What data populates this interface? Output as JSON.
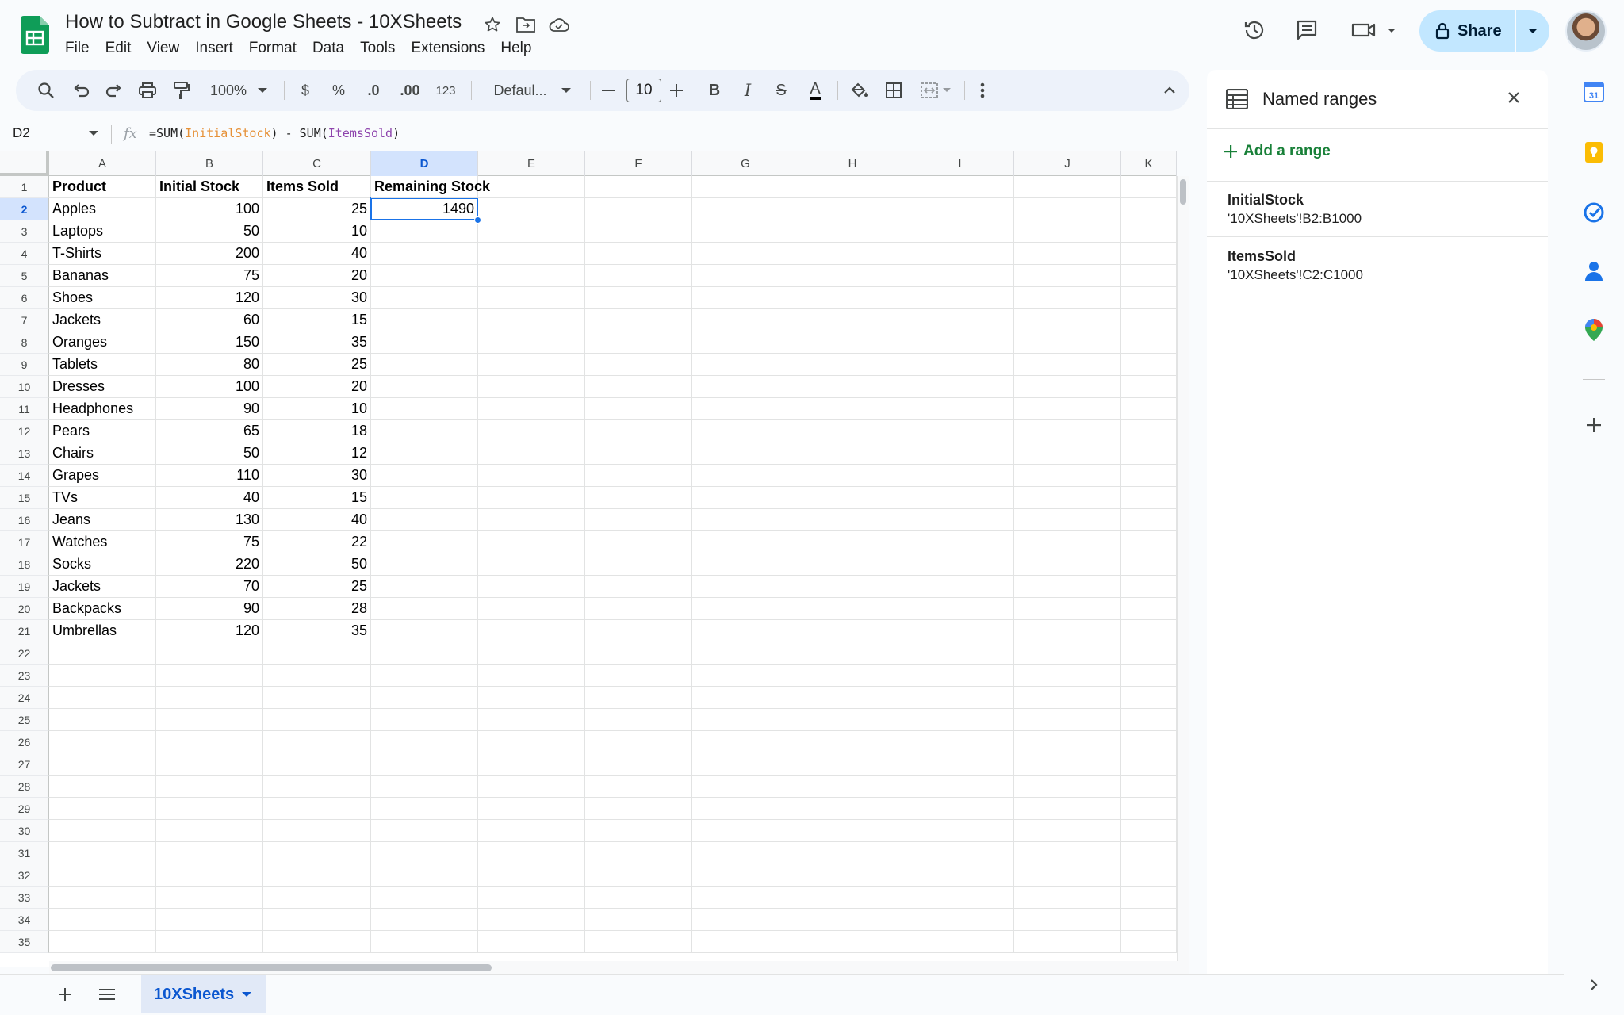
{
  "app": {
    "doc_title": "How to Subtract in Google Sheets - 10XSheets",
    "menu": [
      "File",
      "Edit",
      "View",
      "Insert",
      "Format",
      "Data",
      "Tools",
      "Extensions",
      "Help"
    ],
    "share_label": "Share"
  },
  "toolbar": {
    "zoom": "100%",
    "currency": "$",
    "percent": "%",
    "dec_decrease": ".0",
    "dec_increase": ".00",
    "number_format": "123",
    "font": "Defaul...",
    "font_size": "10",
    "bold": "B",
    "italic": "I",
    "strike": "S",
    "text_color": "A"
  },
  "formula_bar": {
    "cell_ref": "D2",
    "fx": "fx",
    "formula_prefix": "=SUM(",
    "formula_arg1": "InitialStock",
    "formula_mid": ") - SUM(",
    "formula_arg2": "ItemsSold",
    "formula_suffix": ")"
  },
  "grid": {
    "columns": [
      "A",
      "B",
      "C",
      "D",
      "E",
      "F",
      "G",
      "H",
      "I",
      "J",
      "K"
    ],
    "selected_column": "D",
    "row_numbers": [
      "1",
      "2",
      "3",
      "4",
      "5",
      "6",
      "7",
      "8",
      "9",
      "10",
      "11",
      "12",
      "13",
      "14",
      "15",
      "16",
      "17",
      "18",
      "19",
      "20",
      "21",
      "22",
      "23",
      "24",
      "25",
      "26",
      "27",
      "28",
      "29",
      "30",
      "31",
      "32",
      "33",
      "34",
      "35"
    ],
    "selected_row": "2",
    "headers": [
      "Product",
      "Initial Stock",
      "Items Sold",
      "Remaining Stock"
    ],
    "rows": [
      [
        "Apples",
        "100",
        "25",
        "1490"
      ],
      [
        "Laptops",
        "50",
        "10",
        ""
      ],
      [
        "T-Shirts",
        "200",
        "40",
        ""
      ],
      [
        "Bananas",
        "75",
        "20",
        ""
      ],
      [
        "Shoes",
        "120",
        "30",
        ""
      ],
      [
        "Jackets",
        "60",
        "15",
        ""
      ],
      [
        "Oranges",
        "150",
        "35",
        ""
      ],
      [
        "Tablets",
        "80",
        "25",
        ""
      ],
      [
        "Dresses",
        "100",
        "20",
        ""
      ],
      [
        "Headphones",
        "90",
        "10",
        ""
      ],
      [
        "Pears",
        "65",
        "18",
        ""
      ],
      [
        "Chairs",
        "50",
        "12",
        ""
      ],
      [
        "Grapes",
        "110",
        "30",
        ""
      ],
      [
        "TVs",
        "40",
        "15",
        ""
      ],
      [
        "Jeans",
        "130",
        "40",
        ""
      ],
      [
        "Watches",
        "75",
        "22",
        ""
      ],
      [
        "Socks",
        "220",
        "50",
        ""
      ],
      [
        "Jackets",
        "70",
        "25",
        ""
      ],
      [
        "Backpacks",
        "90",
        "28",
        ""
      ],
      [
        "Umbrellas",
        "120",
        "35",
        ""
      ]
    ]
  },
  "sheet_tabs": [
    {
      "label": "10XSheets",
      "active": true
    }
  ],
  "named_ranges_panel": {
    "title": "Named ranges",
    "add_label": "Add a range",
    "ranges": [
      {
        "name": "InitialStock",
        "ref": "'10XSheets'!B2:B1000"
      },
      {
        "name": "ItemsSold",
        "ref": "'10XSheets'!C2:C1000"
      }
    ]
  },
  "colors": {
    "accent": "#1a73e8",
    "share_bg": "#c2e7ff",
    "add_range_green": "#188038",
    "selection_header": "#d3e3fd"
  }
}
